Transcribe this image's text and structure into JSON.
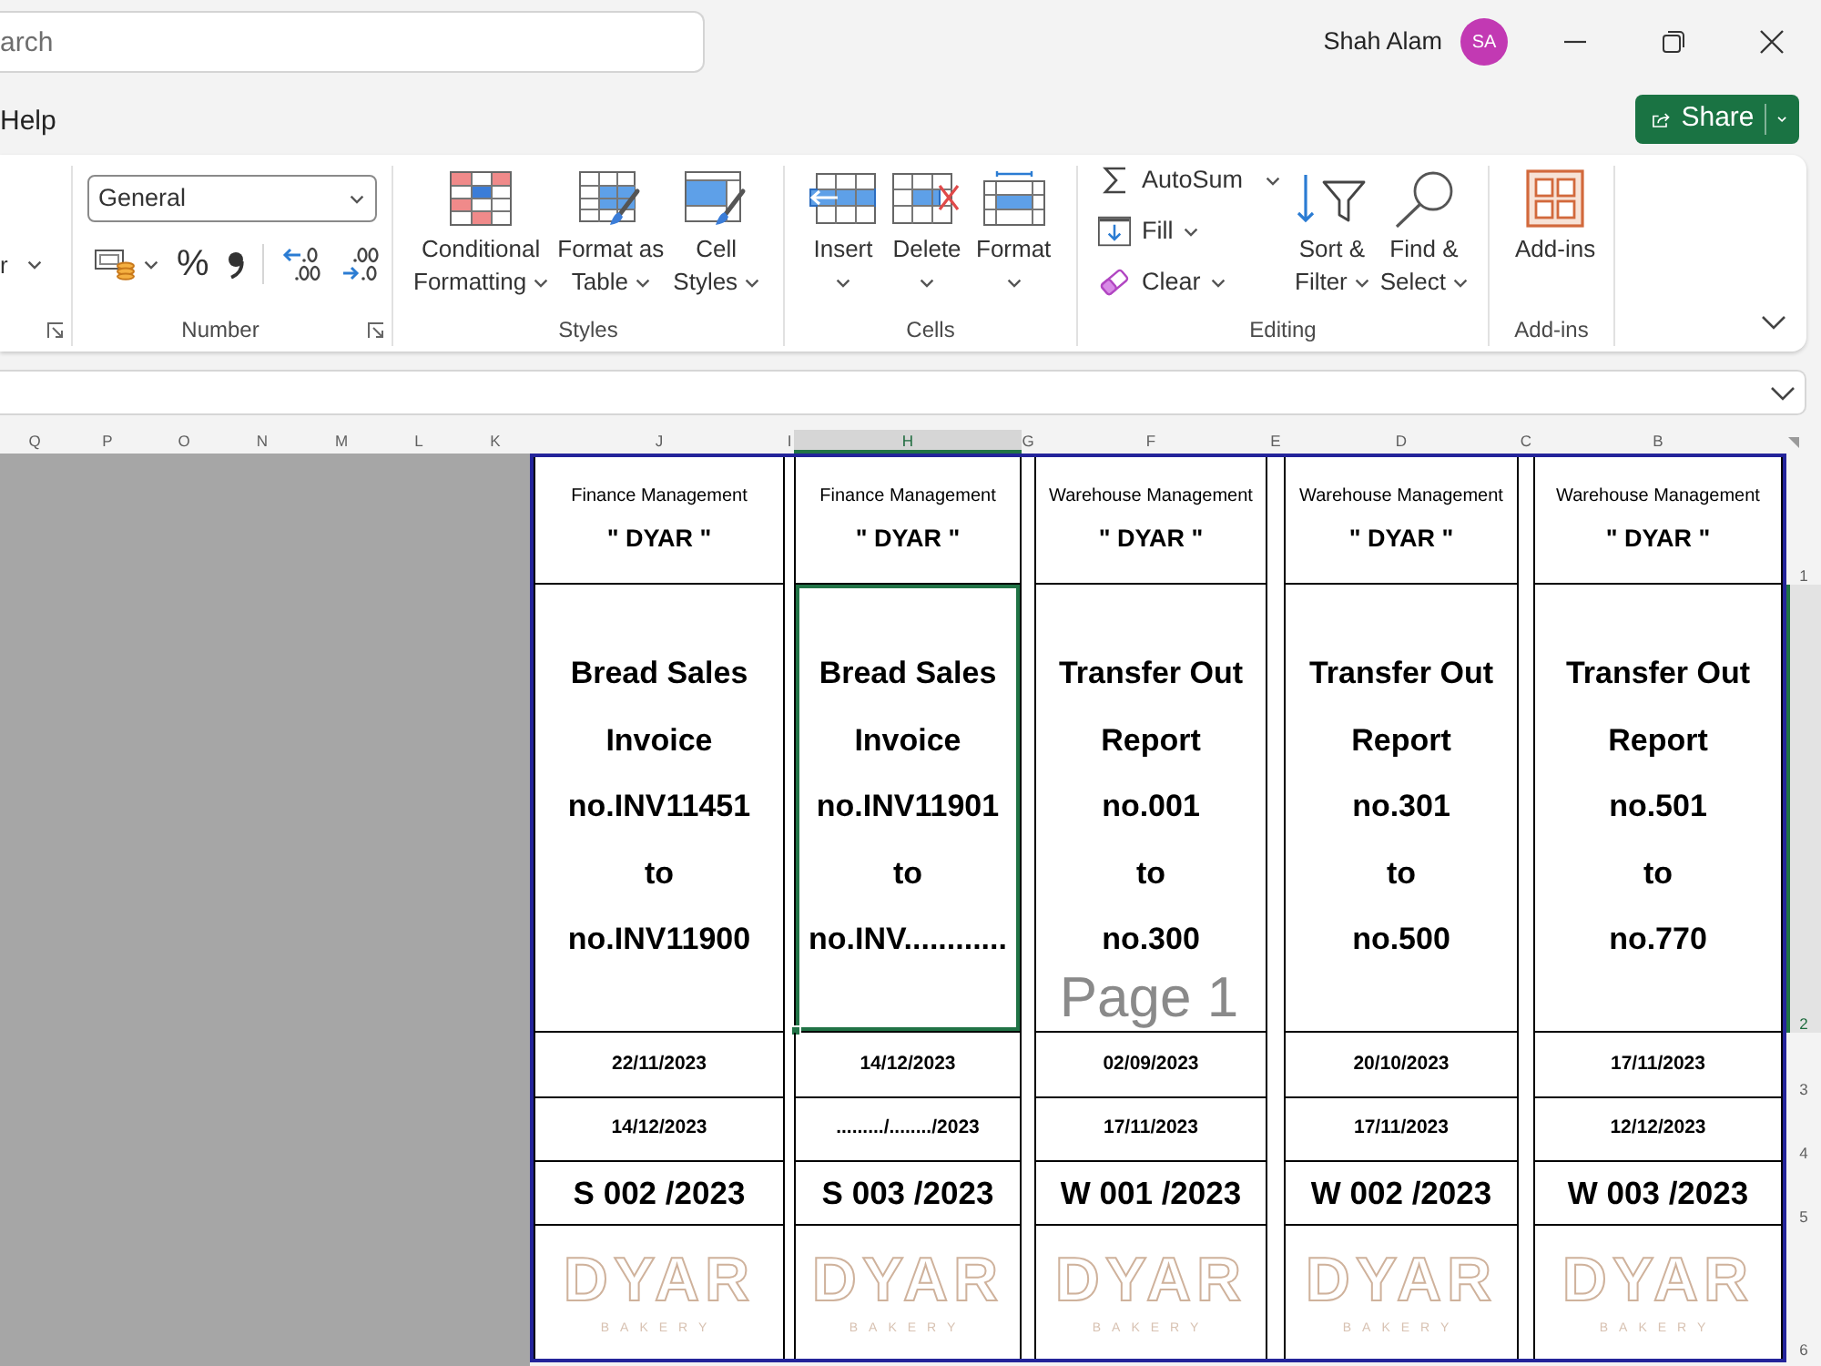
{
  "title_bar": {
    "search": {
      "placeholder": "arch"
    },
    "user": {
      "name": "Shah Alam",
      "initials": "SA"
    }
  },
  "tabs": [
    {
      "label": "Help",
      "selected": false
    }
  ],
  "share": {
    "label": "Share",
    "dropdown": true
  },
  "ribbon": {
    "groups": [
      {
        "launcher": true,
        "items": [
          {
            "kind": "menu",
            "label": "r",
            "dropdown": true
          }
        ]
      },
      {
        "label": "Number",
        "launcher": true,
        "items": [
          {
            "kind": "combo",
            "value": "General"
          },
          {
            "kind": "icon",
            "dropdown": true
          },
          {
            "kind": "glyph",
            "text": "%"
          },
          {
            "kind": "icon",
            "dropdown": false
          },
          {
            "kind": "separator"
          },
          {
            "kind": "icon",
            "dropdown": false
          },
          {
            "kind": "icon",
            "dropdown": false
          }
        ]
      },
      {
        "label": "Styles",
        "items": [
          {
            "kind": "large",
            "lines": [
              "Conditional",
              "Formatting"
            ],
            "dropdown": true
          },
          {
            "kind": "large",
            "lines": [
              "Format as",
              "Table"
            ],
            "dropdown": true
          },
          {
            "kind": "large",
            "lines": [
              "Cell",
              "Styles"
            ],
            "dropdown": true
          }
        ]
      },
      {
        "label": "Cells",
        "items": [
          {
            "kind": "large",
            "lines": [
              "Insert"
            ],
            "dropdown": true
          },
          {
            "kind": "large",
            "lines": [
              "Delete"
            ],
            "dropdown": true
          },
          {
            "kind": "large",
            "lines": [
              "Format"
            ],
            "dropdown": true
          }
        ]
      },
      {
        "label": "Editing",
        "items": [
          {
            "kind": "small",
            "label": "AutoSum",
            "dropdown": true,
            "split": true
          },
          {
            "kind": "small",
            "label": "Fill",
            "dropdown": true,
            "split": false
          },
          {
            "kind": "small",
            "label": "Clear",
            "dropdown": true,
            "split": false
          },
          {
            "kind": "large",
            "lines": [
              "Sort &",
              "Filter"
            ],
            "dropdown": true
          },
          {
            "kind": "large",
            "lines": [
              "Find &",
              "Select"
            ],
            "dropdown": true
          }
        ]
      },
      {
        "label": "Add-ins",
        "items": [
          {
            "kind": "large",
            "lines": [
              "Add-ins"
            ],
            "dropdown": false
          }
        ]
      }
    ]
  },
  "sheet": {
    "column_headers": [
      {
        "label": "Q",
        "selected": false
      },
      {
        "label": "P",
        "selected": false
      },
      {
        "label": "O",
        "selected": false
      },
      {
        "label": "N",
        "selected": false
      },
      {
        "label": "M",
        "selected": false
      },
      {
        "label": "L",
        "selected": false
      },
      {
        "label": "K",
        "selected": false
      },
      {
        "label": "J",
        "selected": false
      },
      {
        "label": "I",
        "selected": false
      },
      {
        "label": "H",
        "selected": true
      },
      {
        "label": "G",
        "selected": false
      },
      {
        "label": "F",
        "selected": false
      },
      {
        "label": "E",
        "selected": false
      },
      {
        "label": "D",
        "selected": false
      },
      {
        "label": "C",
        "selected": false
      },
      {
        "label": "B",
        "selected": false
      }
    ],
    "row_headers": [
      {
        "label": "1",
        "selected": false
      },
      {
        "label": "2",
        "selected": true
      },
      {
        "label": "3",
        "selected": false
      },
      {
        "label": "4",
        "selected": false
      },
      {
        "label": "5",
        "selected": false
      },
      {
        "label": "6",
        "selected": false
      }
    ],
    "page_label": "Page 1",
    "pages": [
      {
        "department": "Finance Management",
        "brand": "\" DYAR \"",
        "title": {
          "text": "Bread Sales\nInvoice\nno.INV11451\nto\nno.INV11900",
          "selected": false
        },
        "first_date": "22/11/2023",
        "second_date": "14/12/2023",
        "serial": "S 002 /2023",
        "logo": {
          "name": "DYAR",
          "tagline": "BAKERY"
        }
      },
      {
        "department": "Finance Management",
        "brand": "\" DYAR \"",
        "title": {
          "text": "Bread Sales\nInvoice\nno.INV11901\nto\nno.INV............",
          "selected": true
        },
        "first_date": "14/12/2023",
        "second_date": "........./......../2023",
        "serial": "S 003 /2023",
        "logo": {
          "name": "DYAR",
          "tagline": "BAKERY"
        }
      },
      {
        "department": "Warehouse Management",
        "brand": "\" DYAR \"",
        "title": {
          "text": "Transfer Out\nReport\nno.001\nto\nno.300",
          "selected": false
        },
        "first_date": "02/09/2023",
        "second_date": "17/11/2023",
        "serial": "W 001 /2023",
        "logo": {
          "name": "DYAR",
          "tagline": "BAKERY"
        }
      },
      {
        "department": "Warehouse Management",
        "brand": "\" DYAR \"",
        "title": {
          "text": "Transfer Out\nReport\nno.301\nto\nno.500",
          "selected": false
        },
        "first_date": "20/10/2023",
        "second_date": "17/11/2023",
        "serial": "W 002 /2023",
        "logo": {
          "name": "DYAR",
          "tagline": "BAKERY"
        }
      },
      {
        "department": "Warehouse Management",
        "brand": "\" DYAR \"",
        "title": {
          "text": "Transfer Out\nReport\nno.501\nto\nno.770",
          "selected": false
        },
        "first_date": "17/11/2023",
        "second_date": "12/12/2023",
        "serial": "W 003 /2023",
        "logo": {
          "name": "DYAR",
          "tagline": "BAKERY"
        }
      }
    ]
  }
}
